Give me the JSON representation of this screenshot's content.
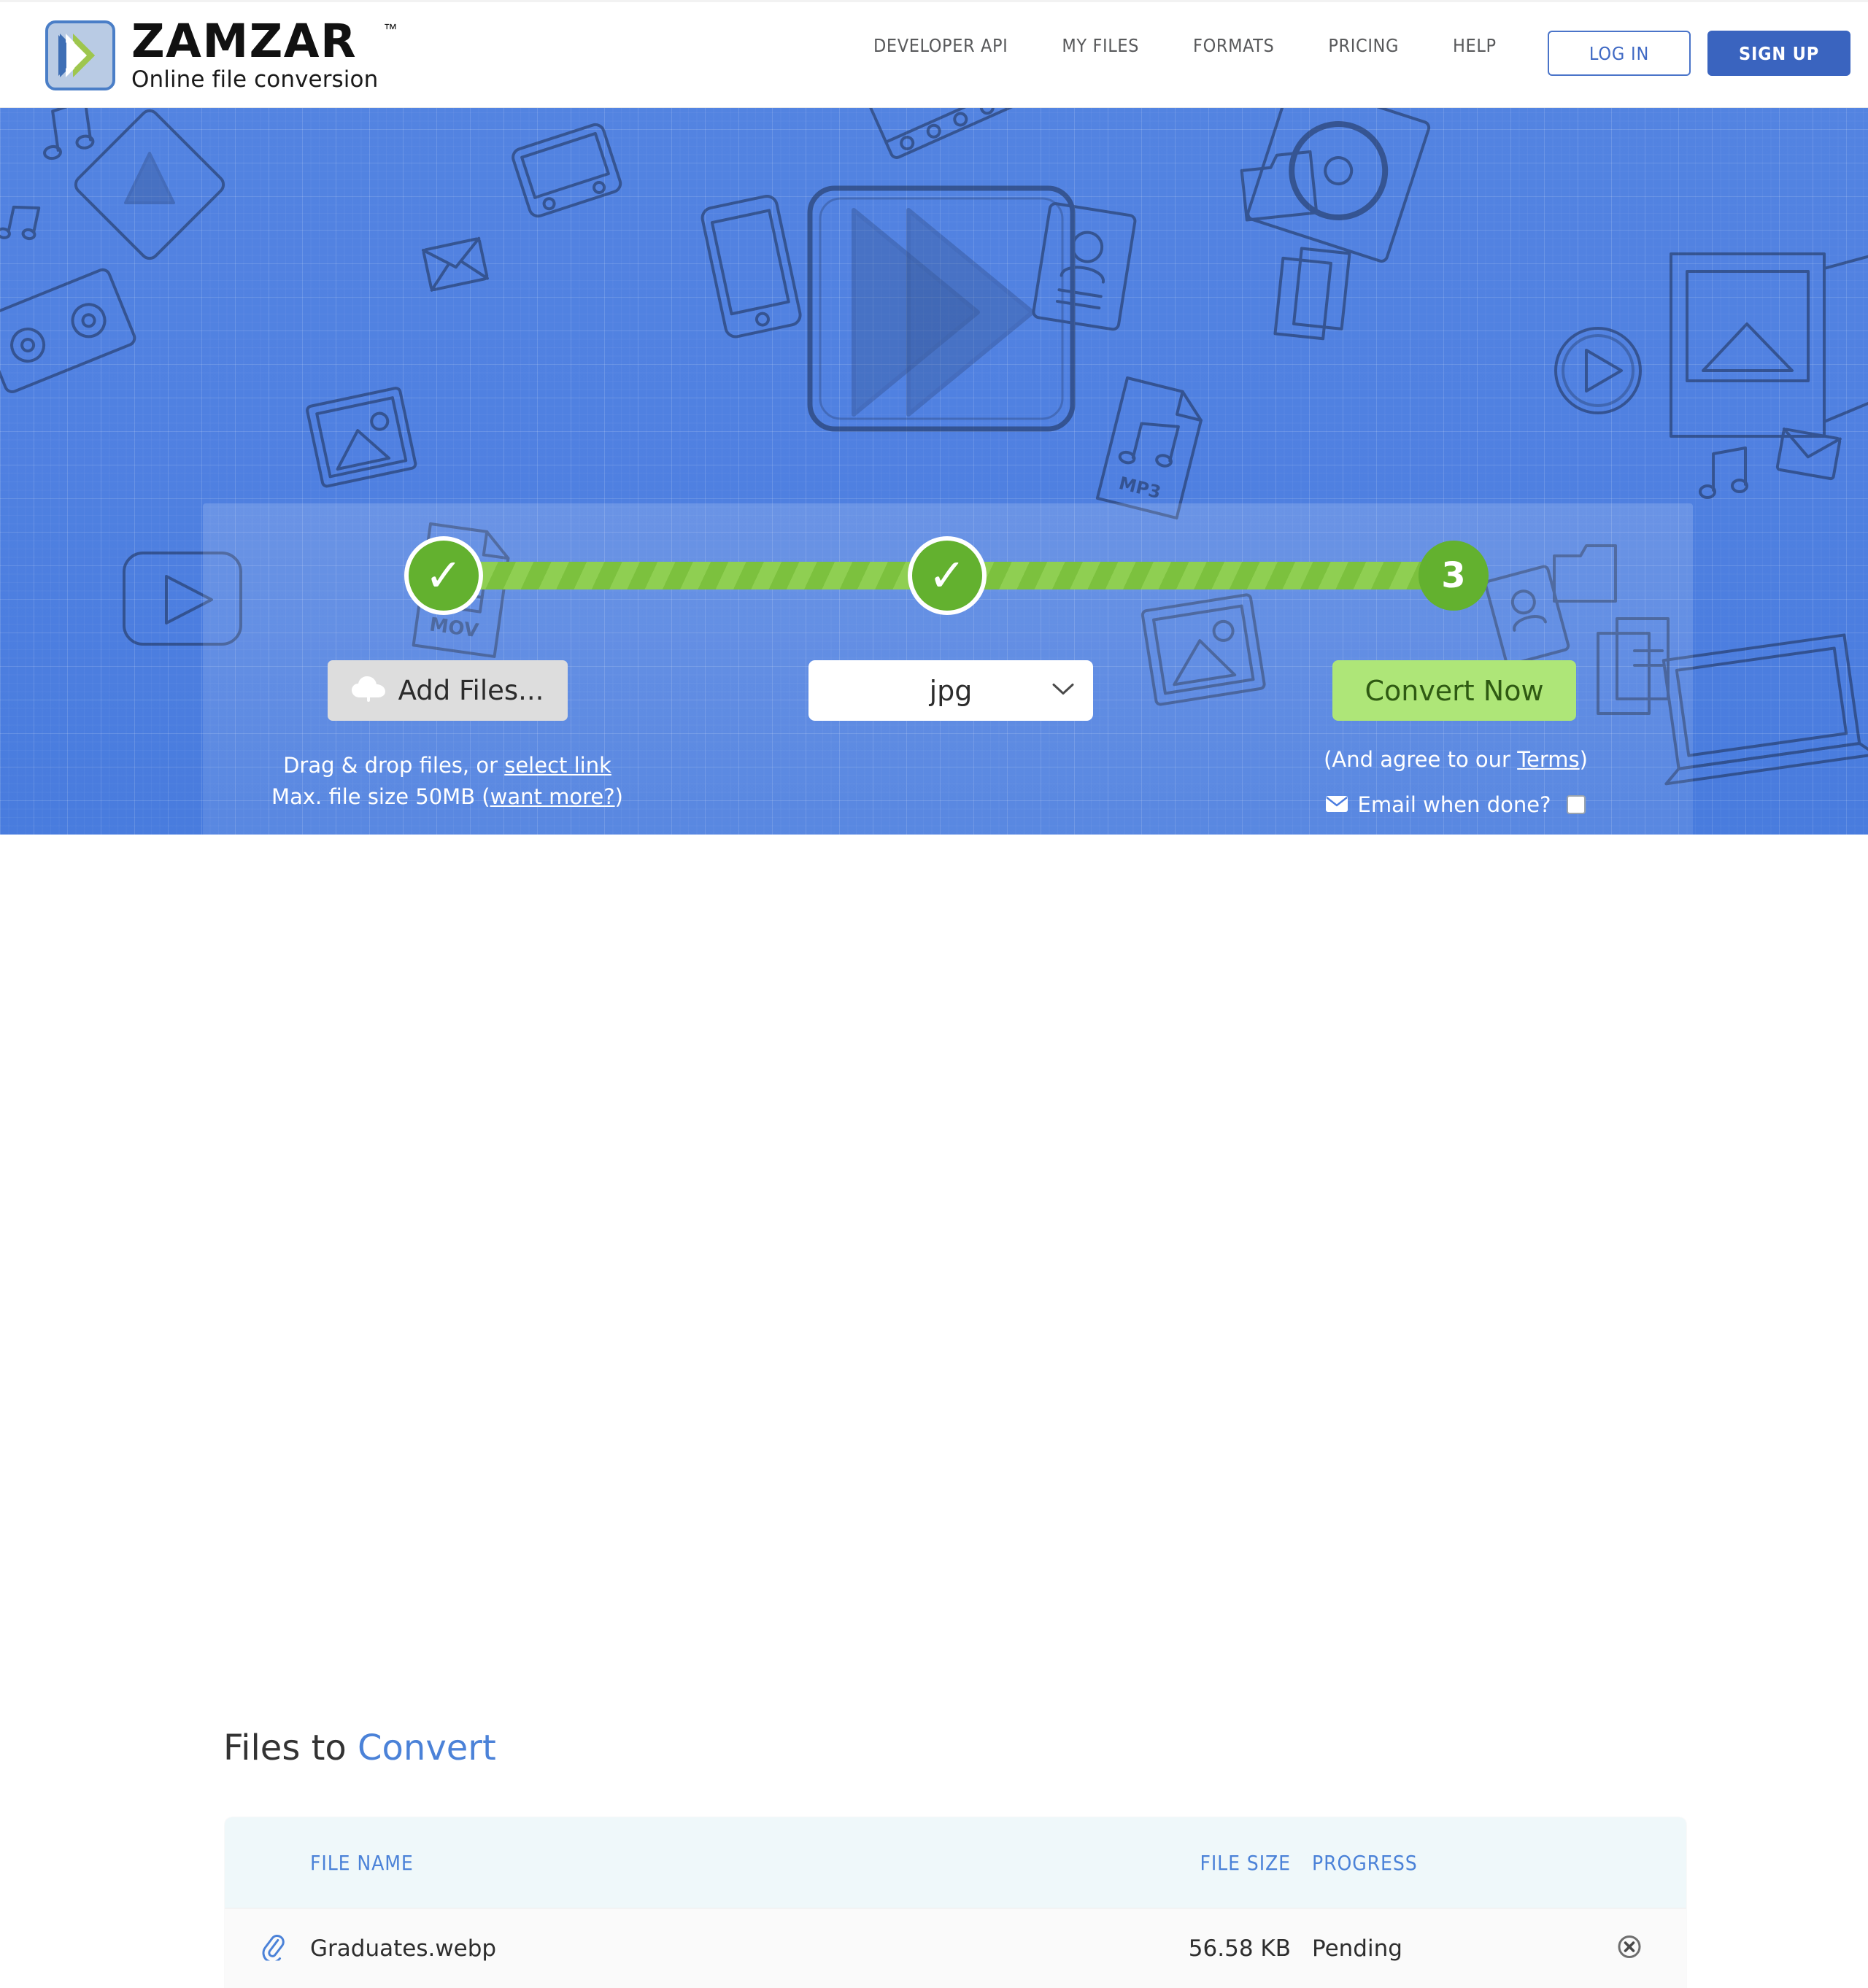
{
  "header": {
    "logo": {
      "word": "ZAMZAR",
      "tm": "™",
      "tagline": "Online file conversion",
      "mark_icon": "double-chevron-logo-icon"
    },
    "nav": [
      {
        "label": "DEVELOPER API"
      },
      {
        "label": "MY FILES"
      },
      {
        "label": "FORMATS"
      },
      {
        "label": "PRICING"
      },
      {
        "label": "HELP"
      }
    ],
    "login_label": "LOG IN",
    "signup_label": "SIGN UP",
    "accent_blue": "#3a64bf"
  },
  "hero": {
    "background_color": "#4a7ce0",
    "steps": [
      {
        "state": "done",
        "glyph": "✓",
        "name": "step-1-add-files"
      },
      {
        "state": "done",
        "glyph": "✓",
        "name": "step-2-choose-format"
      },
      {
        "state": "current",
        "glyph": "3",
        "name": "step-3-convert"
      }
    ],
    "add_files": {
      "label": "Add Files...",
      "icon": "cloud-upload-icon"
    },
    "hint_line_1_prefix": "Drag & drop files, or ",
    "hint_line_1_link": "select link",
    "hint_line_2_prefix": "Max. file size 50MB (",
    "hint_line_2_link": "want more?",
    "hint_line_2_suffix": ")",
    "format_select": {
      "value": "jpg",
      "icon": "chevron-down-icon"
    },
    "convert": {
      "label": "Convert Now",
      "color": "#aee678",
      "terms_prefix": "(And agree to our ",
      "terms_link": "Terms",
      "terms_suffix": ")",
      "email_icon": "envelope-icon",
      "email_label": "Email when done?",
      "email_checked": false
    }
  },
  "files": {
    "title_prefix": "Files to ",
    "title_accent": "Convert",
    "columns": {
      "name": "FILE NAME",
      "size": "FILE SIZE",
      "progress": "PROGRESS"
    },
    "rows": [
      {
        "icon": "paperclip-icon",
        "name": "Graduates.webp",
        "size": "56.58 KB",
        "progress": "Pending",
        "remove_icon": "remove-circle-icon"
      }
    ]
  }
}
